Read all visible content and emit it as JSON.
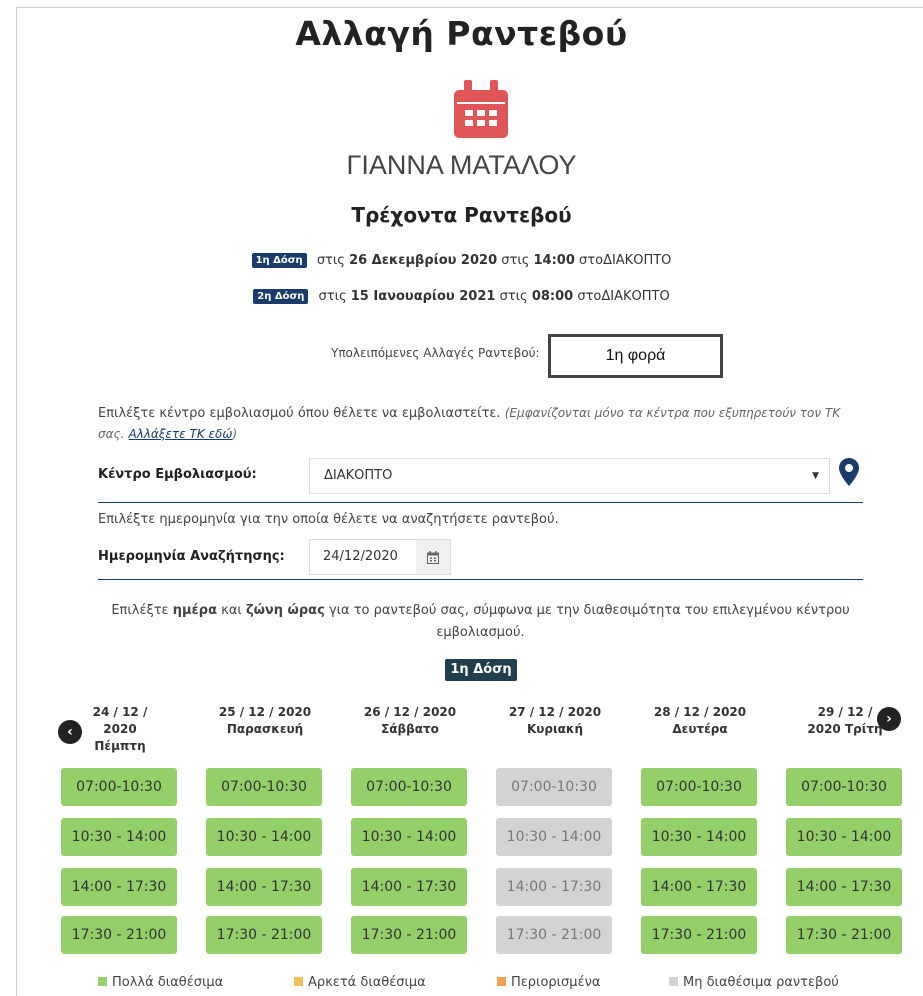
{
  "page": {
    "title": "Αλλαγή Ραντεβού",
    "patient_name": "ΓΙΑΝΝΑ ΜΑΤΑΛΟΥ"
  },
  "current_appointments": {
    "title": "Τρέχοντα Ραντεβού",
    "items": [
      {
        "badge": "1η Δόση",
        "prefix": "στις",
        "date": "26 Δεκεμβρίου 2020",
        "at": "στις",
        "time": "14:00",
        "place_prefix": "στο",
        "place": "ΔΙΑΚΟΠΤΟ"
      },
      {
        "badge": "2η Δόση",
        "prefix": "στις",
        "date": "15 Ιανουαρίου 2021",
        "at": "στις",
        "time": "08:00",
        "place_prefix": "στο",
        "place": "ΔΙΑΚΟΠΤΟ"
      }
    ]
  },
  "remaining": {
    "label": "Υπολειπόμενες Αλλαγές Ραντεβού:",
    "value": "1η φορά"
  },
  "center_section": {
    "instruction": "Επιλέξτε κέντρο εμβολιασμού όπου θέλετε να εμβολιαστείτε.",
    "note": "(Εμφανίζονται μόνο τα κέντρα που εξυπηρετούν τον ΤΚ σας.",
    "change_link": "Αλλάξετε ΤΚ εδώ",
    "note_end": ")",
    "label": "Κέντρο Εμβολιασμού:",
    "selected": "ΔΙΑΚΟΠΤΟ"
  },
  "date_section": {
    "instruction": "Επιλέξτε ημερομηνία για την οποία θέλετε να αναζητήσετε ραντεβού.",
    "label": "Ημερομηνία Αναζήτησης:",
    "value": "24/12/2020"
  },
  "slots_section": {
    "instr_a": "Επιλέξτε",
    "instr_b": "ημέρα",
    "instr_c": "και",
    "instr_d": "ζώνη ώρας",
    "instr_e": "για το ραντεβού σας, σύμφωνα με την διαθεσιμότητα του επιλεγμένου κέντρου εμβολιασμού.",
    "dose_label": "1η Δόση",
    "prev_icon": "‹",
    "next_icon": "›",
    "days": [
      {
        "line1": "24 / 12 /",
        "line2": "2020",
        "line3": "Πέμπτη",
        "status": "available"
      },
      {
        "line1": "25 / 12 / 2020",
        "line2": "Παρασκευή",
        "line3": "",
        "status": "available"
      },
      {
        "line1": "26 / 12 / 2020",
        "line2": "Σάββατο",
        "line3": "",
        "status": "available"
      },
      {
        "line1": "27 / 12 / 2020",
        "line2": "Κυριακή",
        "line3": "",
        "status": "unavailable"
      },
      {
        "line1": "28 / 12 / 2020",
        "line2": "Δευτέρα",
        "line3": "",
        "status": "available"
      },
      {
        "line1": "29 / 12 /",
        "line2": "2020 Τρίτη",
        "line3": "",
        "status": "available"
      }
    ],
    "time_slots": [
      "07:00-10:30",
      "10:30 - 14:00",
      "14:00 - 17:30",
      "17:30 - 21:00"
    ]
  },
  "legend": [
    {
      "label": "Πολλά διαθέσιμα",
      "color": "#95cf6a"
    },
    {
      "label": "Αρκετά διαθέσιμα",
      "color": "#f0c05a"
    },
    {
      "label": "Περιορισμένα",
      "color": "#f0a050"
    },
    {
      "label": "Μη διαθέσιμα ραντεβού",
      "color": "#d3d3d3"
    }
  ],
  "colors": {
    "available": "#95cf6a",
    "unavailable": "#d3d3d3",
    "brand_dark": "#1a3c6b",
    "calendar_red": "#e05558"
  }
}
